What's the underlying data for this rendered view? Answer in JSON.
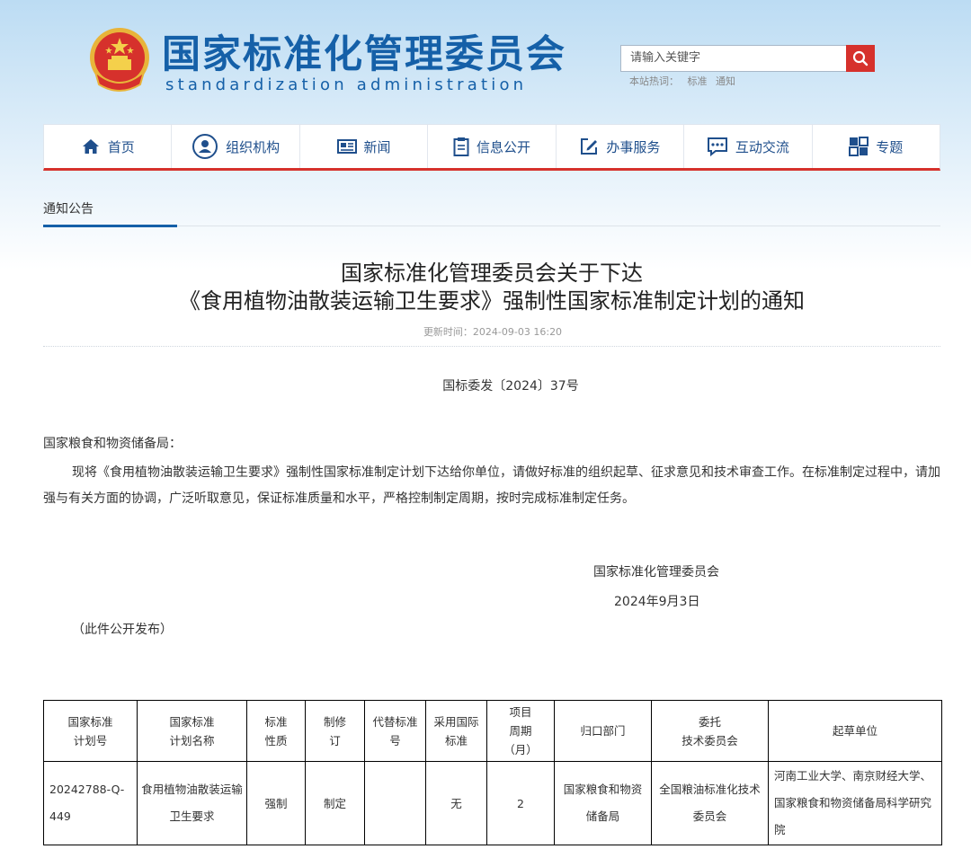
{
  "header": {
    "site_title": "国家标准化管理委员会",
    "site_subtitle": "standardization administration",
    "search": {
      "placeholder": "请输入关键字",
      "hot_label": "本站热词：",
      "hot_words": [
        "标准",
        "通知"
      ]
    }
  },
  "nav": {
    "items": [
      {
        "label": "首页",
        "icon": "home-icon"
      },
      {
        "label": "组织机构",
        "icon": "user-circle-icon"
      },
      {
        "label": "新闻",
        "icon": "newspaper-icon"
      },
      {
        "label": "信息公开",
        "icon": "clipboard-icon"
      },
      {
        "label": "办事服务",
        "icon": "edit-icon"
      },
      {
        "label": "互动交流",
        "icon": "chat-icon"
      },
      {
        "label": "专题",
        "icon": "topic-icon"
      }
    ]
  },
  "breadcrumb": {
    "label": "通知公告"
  },
  "article": {
    "title_line1": "国家标准化管理委员会关于下达",
    "title_line2": "《食用植物油散装运输卫生要求》强制性国家标准制定计划的通知",
    "update_time": "更新时间：2024-09-03 16:20",
    "doc_number": "国标委发〔2024〕37号",
    "salutation": "国家粮食和物资储备局：",
    "body": "现将《食用植物油散装运输卫生要求》强制性国家标准制定计划下达给你单位，请做好标准的组织起草、征求意见和技术审查工作。在标准制定过程中，请加强与有关方面的协调，广泛听取意见，保证标准质量和水平，严格控制制定周期，按时完成标准制定任务。",
    "signature_org": "国家标准化管理委员会",
    "signature_date": "2024年9月3日",
    "publish_note": "（此件公开发布）"
  },
  "table": {
    "headers": [
      "国家标准\n计划号",
      "国家标准\n计划名称",
      "标准\n性质",
      "制修\n订",
      "代替标准\n号",
      "采用国际\n标准",
      "项目\n周期\n（月）",
      "归口部门",
      "委托\n技术委员会",
      "起草单位"
    ],
    "rows": [
      [
        "20242788-Q-449",
        "食用植物油散装运输卫生要求",
        "强制",
        "制定",
        "",
        "无",
        "2",
        "国家粮食和物资储备局",
        "全国粮油标准化技术委员会",
        "河南工业大学、南京财经大学、国家粮食和物资储备局科学研究院"
      ]
    ]
  },
  "colors": {
    "brand_blue": "#1560a8",
    "accent_red": "#d6312c"
  }
}
